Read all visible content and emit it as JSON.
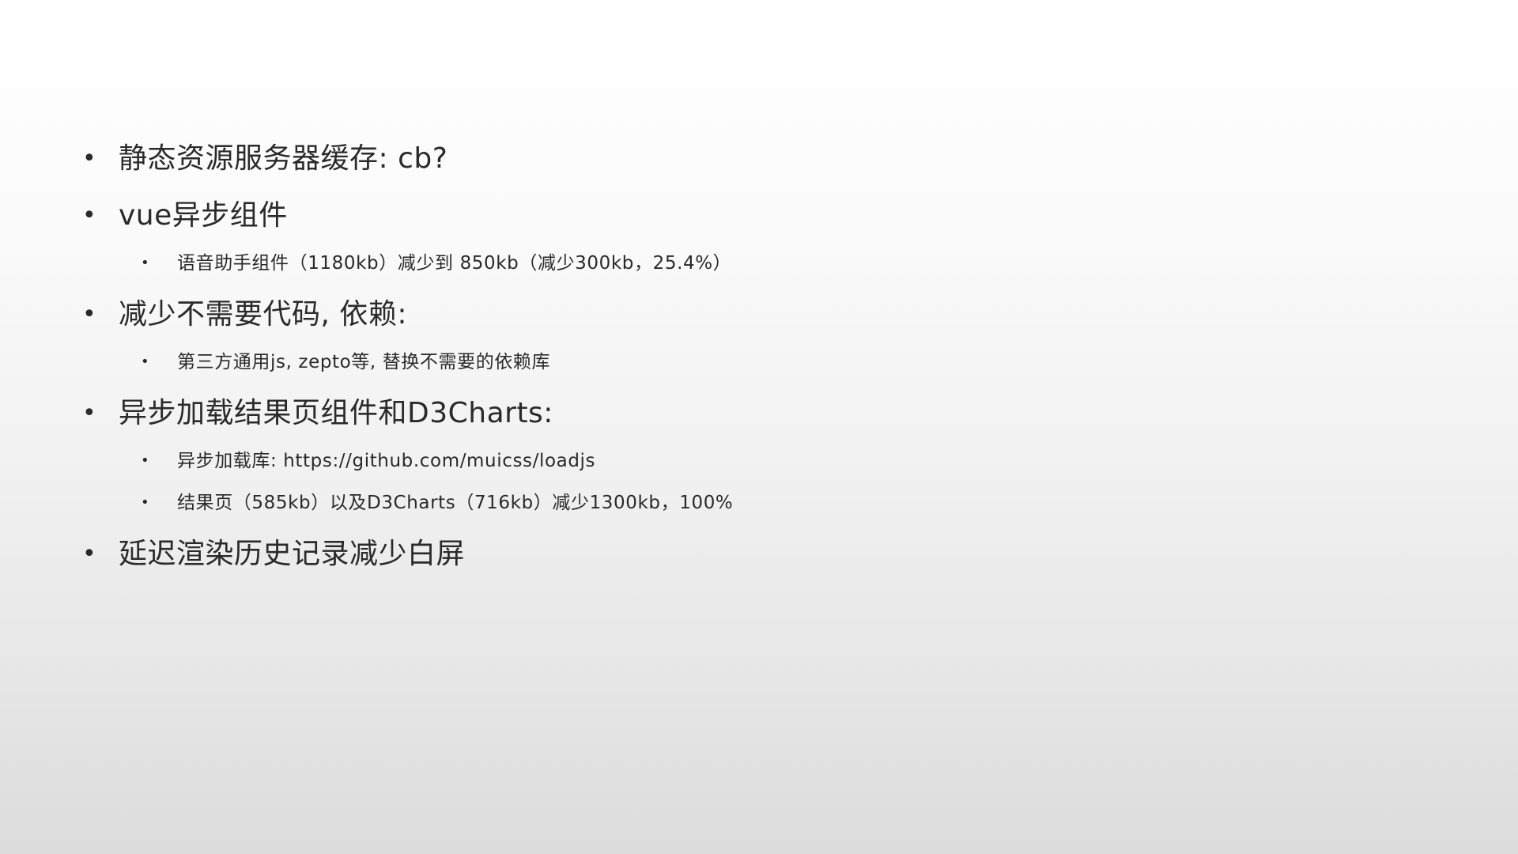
{
  "slide": {
    "items": [
      {
        "level": 1,
        "text": "静态资源服务器缓存: cb?"
      },
      {
        "level": 1,
        "text": "vue异步组件"
      },
      {
        "level": 2,
        "text": "语音助手组件（1180kb）减少到 850kb（减少300kb，25.4%）"
      },
      {
        "level": 1,
        "text": "减少不需要代码, 依赖:"
      },
      {
        "level": 2,
        "text": "第三方通用js, zepto等, 替换不需要的依赖库"
      },
      {
        "level": 1,
        "text": "异步加载结果页组件和D3Charts:"
      },
      {
        "level": 2,
        "text": "异步加载库: https://github.com/muicss/loadjs"
      },
      {
        "level": 2,
        "text": "结果页（585kb）以及D3Charts（716kb）减少1300kb，100%"
      },
      {
        "level": 1,
        "text": "延迟渲染历史记录减少白屏"
      }
    ],
    "bullet_glyph": "•"
  }
}
